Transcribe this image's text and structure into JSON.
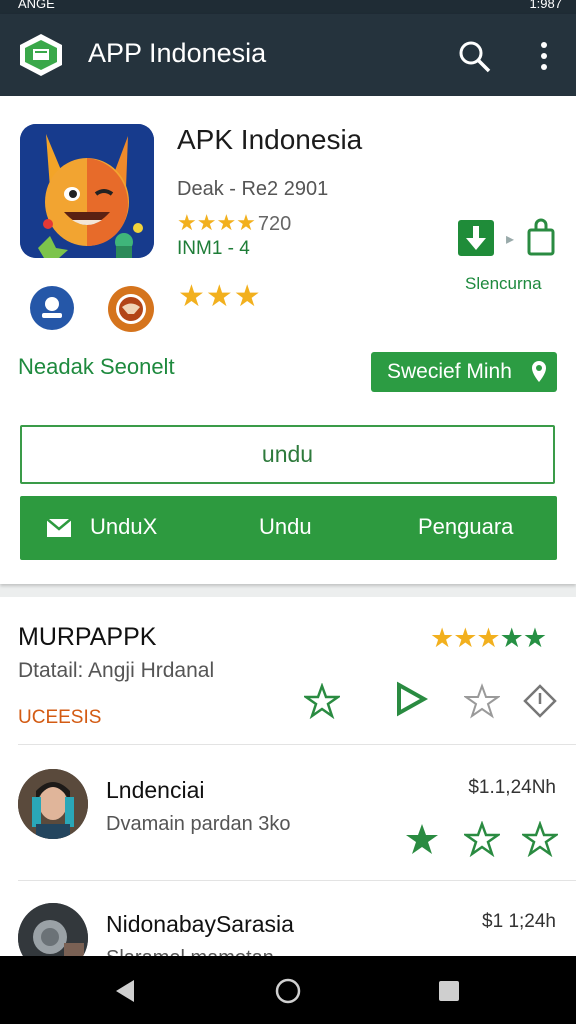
{
  "status_bar": {
    "left_text": "ANGE",
    "time": "1:987"
  },
  "app_bar": {
    "title": "APP Indonesia"
  },
  "app": {
    "name": "APK Indonesia",
    "developer_line": "Deak - Re2 2901",
    "rating_stars": "★★★★",
    "rating_count": "720",
    "size_line": "INM1 - 4",
    "side_label": "Slencurna",
    "secondary_stars": "★★★",
    "left_label": "Neadak  Seonelt",
    "pill_label": "Swecief Minh",
    "outline_button": "undu",
    "bar_buttons": [
      "UnduX",
      "Undu",
      "Penguara"
    ]
  },
  "section": {
    "title": "MURPAPPK",
    "subtitle": "Dtatail: Angji Hrdanal",
    "tag": "UCEESIS",
    "stars_gold": "★★★",
    "stars_green": "★★"
  },
  "rows": [
    {
      "title": "Lndenciai",
      "subtitle": "Dvamain pardan 3ko",
      "price": "$1.1,24Nh"
    },
    {
      "title": "NidonabaySarasia",
      "subtitle": "Slaramel mamotan",
      "price": "$1 1;24h"
    }
  ],
  "colors": {
    "accent": "#2c9c43",
    "toolbar": "#25333d",
    "star": "#f2b01e"
  }
}
